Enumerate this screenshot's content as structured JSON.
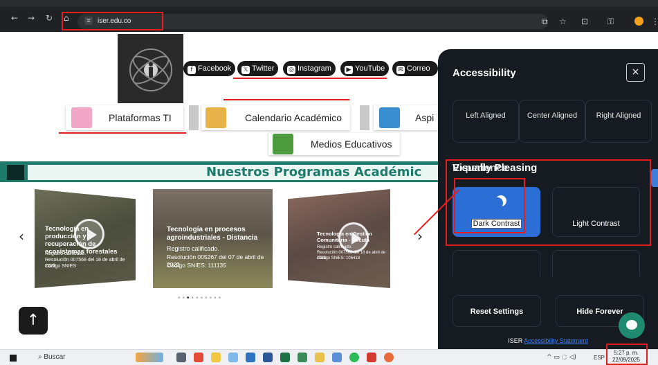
{
  "browser": {
    "url": "iser.edu.co",
    "nav_icons": [
      "back-icon",
      "forward-icon",
      "reload-icon",
      "home-icon"
    ],
    "toolbar_icons": [
      "cast-icon",
      "star-icon",
      "extensions-icon",
      "password-key-icon",
      "profile-icon",
      "menu-icon"
    ]
  },
  "header": {
    "social": [
      {
        "label": "Facebook",
        "icon": "f"
      },
      {
        "label": "Twitter",
        "icon": "𝕏"
      },
      {
        "label": "Instagram",
        "icon": "◎"
      },
      {
        "label": "YouTube",
        "icon": "▶"
      },
      {
        "label": "Correo",
        "icon": "✉"
      }
    ],
    "platforms": [
      "Plataformas TI",
      "Calendario Académico",
      "Aspi"
    ],
    "medios": "Medios Educativos"
  },
  "programs": {
    "title": "Nuestros Programas Académic",
    "cards": [
      {
        "title": "Tecnología en producción y recuperación de ecosistemas forestales",
        "lines": [
          "Registro calificado.",
          "Resolución 007568 del 18 de abril de 2023",
          "Código SNIES"
        ]
      },
      {
        "title": "Tecnología en procesos agroindustriales - Distancia",
        "lines": [
          "Registro calificado.",
          "Resolución 005267 del 07 de abril de 2022",
          "Código SNIES: 111135"
        ]
      },
      {
        "title": "Tecnología en Gestión Comunitaria - Cúcuta",
        "lines": [
          "Registro calificado.",
          "Resolución 007568 del 18 de abril de 2022",
          "Código SNIES: 106418"
        ]
      }
    ],
    "prev": "‹",
    "next": "›",
    "slide_count": 10,
    "active_slide": 3
  },
  "accessibility": {
    "title": "Accessibility",
    "close": "×",
    "alignment": [
      "Left Aligned",
      "Center Aligned",
      "Right Aligned"
    ],
    "section_overlap": [
      "Visually Pleasing",
      "Experience"
    ],
    "contrast_options": [
      {
        "label": "Dark Contrast",
        "active": true
      },
      {
        "label": "Light Contrast",
        "active": false
      }
    ],
    "reset": "Reset Settings",
    "hide": "Hide Forever",
    "footer_brand": "ISER",
    "footer_link": "Accessibility Statement"
  },
  "taskbar": {
    "search": "Buscar",
    "language": "ESP",
    "time": "5:27 p. m.",
    "date": "22/09/2025"
  },
  "colors": {
    "panel": "#161b22",
    "accent": "#2b6fd6",
    "banner": "#1e7a6a",
    "annotation": "#e41d1d"
  }
}
